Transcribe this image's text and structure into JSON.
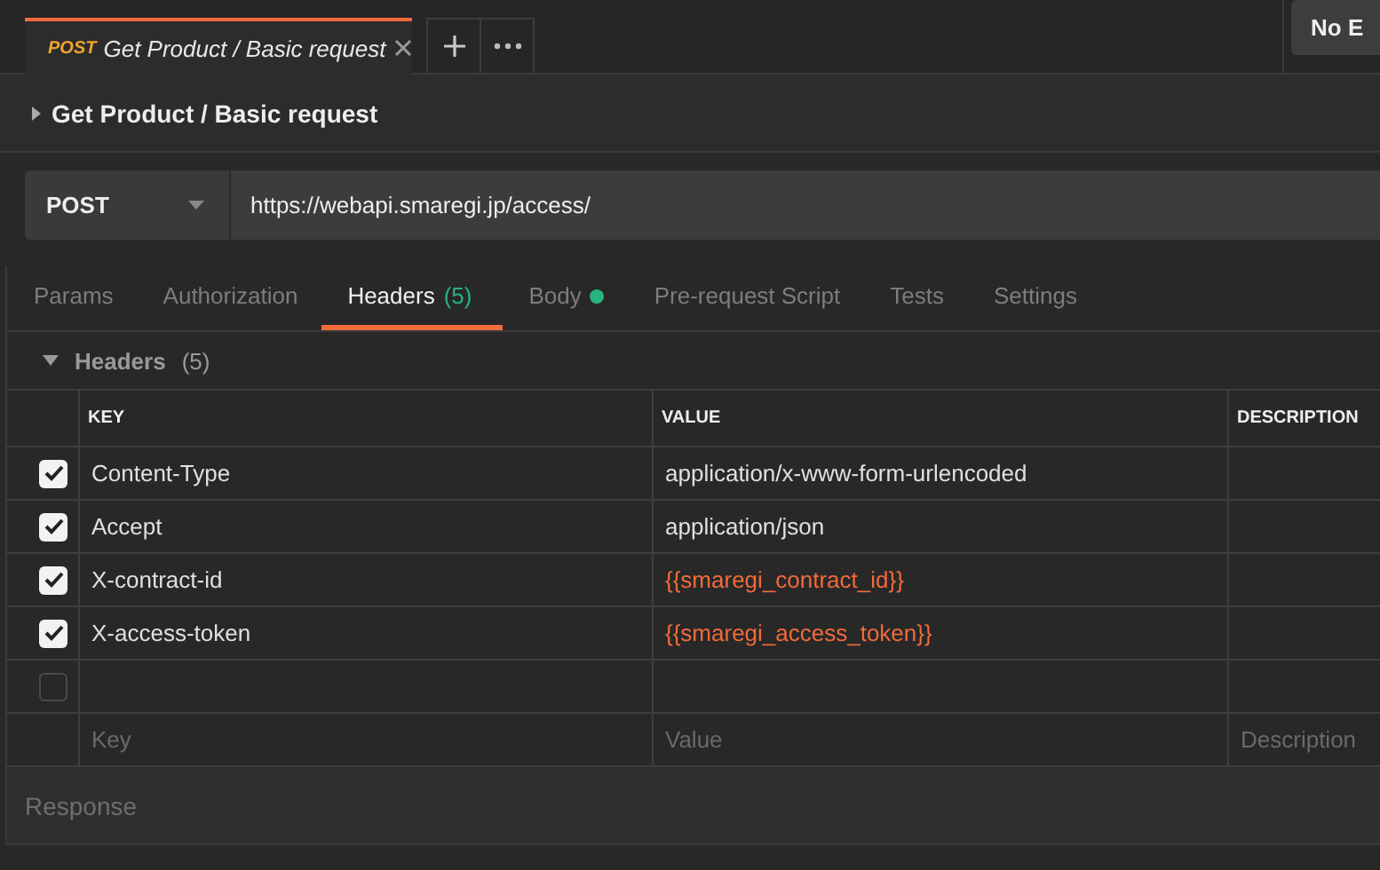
{
  "tabs": [
    {
      "method": "POST",
      "title": "Get Product / Basic request",
      "selected": true
    }
  ],
  "environment": {
    "label": "No E"
  },
  "request": {
    "name": "Get Product / Basic request",
    "method": "POST",
    "url": "https://webapi.smaregi.jp/access/"
  },
  "request_tabs": [
    {
      "label": "Params",
      "selected": false
    },
    {
      "label": "Authorization",
      "selected": false
    },
    {
      "label": "Headers",
      "count": "(5)",
      "selected": true
    },
    {
      "label": "Body",
      "dot": true,
      "selected": false
    },
    {
      "label": "Pre-request Script",
      "selected": false
    },
    {
      "label": "Tests",
      "selected": false
    },
    {
      "label": "Settings",
      "selected": false
    }
  ],
  "headers_section": {
    "title": "Headers",
    "count": "(5)",
    "expanded": true
  },
  "table": {
    "columns": [
      "KEY",
      "VALUE",
      "DESCRIPTION"
    ],
    "rows": [
      {
        "checked": true,
        "key": "Content-Type",
        "value": "application/x-www-form-urlencoded",
        "kind": "text"
      },
      {
        "checked": true,
        "key": "Accept",
        "value": "application/json",
        "kind": "text"
      },
      {
        "checked": true,
        "key": "X-contract-id",
        "value": "{{smaregi_contract_id}}",
        "kind": "variable"
      },
      {
        "checked": true,
        "key": "X-access-token",
        "value": "{{smaregi_access_token}}",
        "kind": "variable"
      },
      {
        "checked": false
      }
    ],
    "new_row": {
      "key_placeholder": "Key",
      "value_placeholder": "Value",
      "description_placeholder": "Description"
    }
  },
  "response": {
    "title": "Response"
  }
}
